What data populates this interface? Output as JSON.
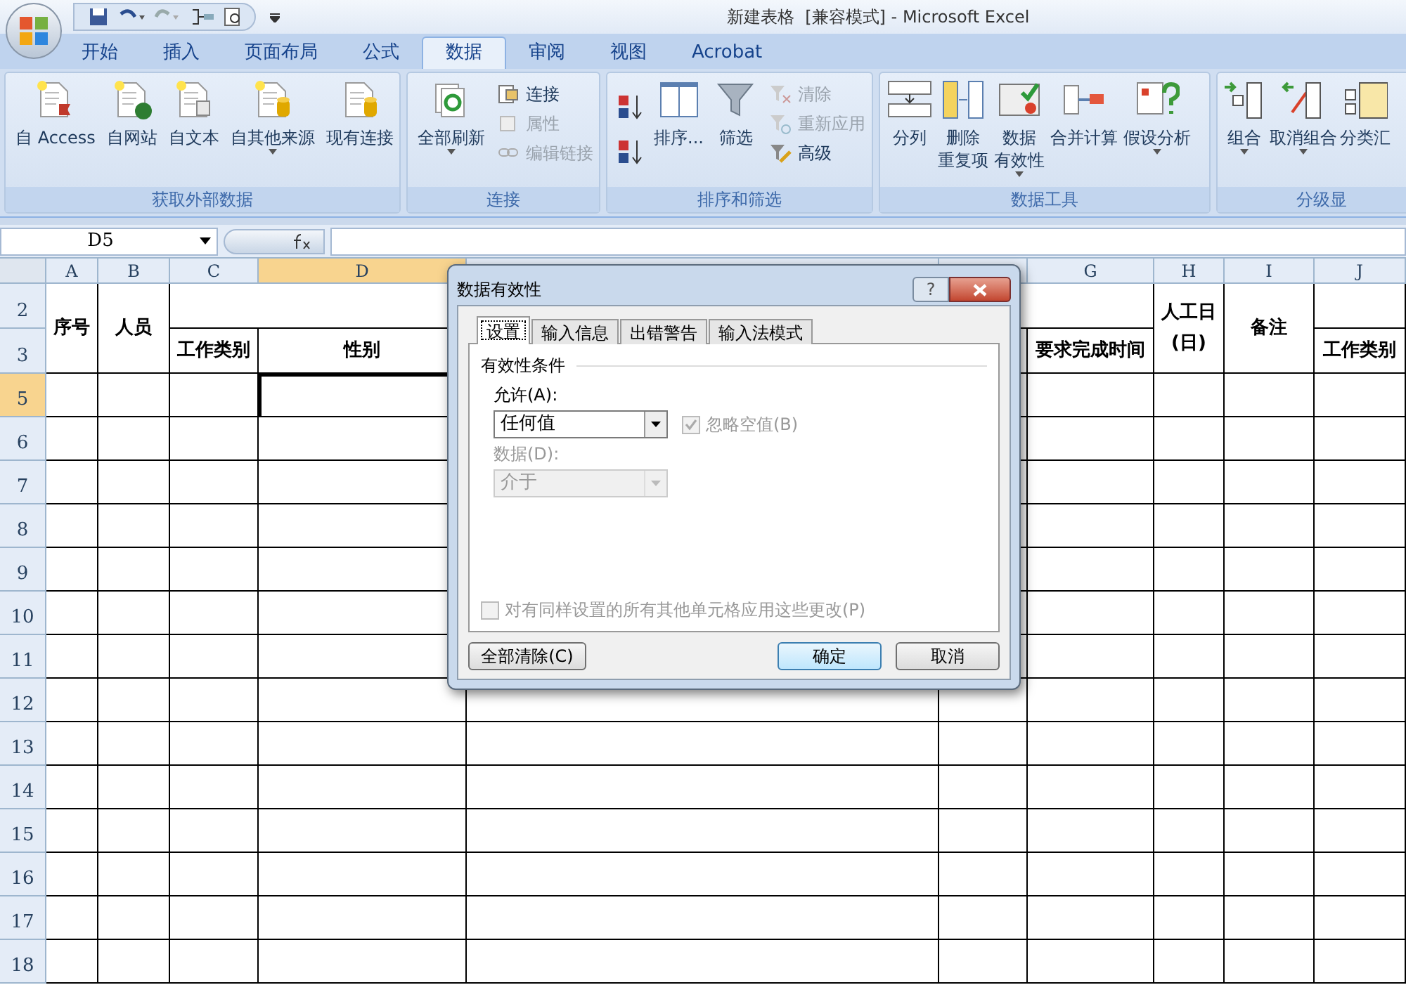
{
  "window": {
    "title": "新建表格  [兼容模式] - Microsoft Excel"
  },
  "tabs": [
    {
      "label": "开始",
      "selected": false
    },
    {
      "label": "插入",
      "selected": false
    },
    {
      "label": "页面布局",
      "selected": false
    },
    {
      "label": "公式",
      "selected": false
    },
    {
      "label": "数据",
      "selected": true
    },
    {
      "label": "审阅",
      "selected": false
    },
    {
      "label": "视图",
      "selected": false
    },
    {
      "label": "Acrobat",
      "selected": false
    }
  ],
  "ribbon": {
    "groups": [
      {
        "label": "获取外部数据",
        "items": [
          {
            "kind": "large",
            "label": "自 Access",
            "disabled": false
          },
          {
            "kind": "large",
            "label": "自网站",
            "disabled": false
          },
          {
            "kind": "large",
            "label": "自文本",
            "disabled": false
          },
          {
            "kind": "large",
            "label": "自其他来源",
            "disabled": false,
            "dropdown": true
          },
          {
            "kind": "large",
            "label": "现有连接",
            "disabled": false
          }
        ]
      },
      {
        "label": "连接",
        "items": [
          {
            "kind": "large",
            "label": "全部刷新",
            "disabled": false,
            "dropdown": true
          },
          {
            "kind": "small",
            "label": "连接",
            "disabled": false
          },
          {
            "kind": "small",
            "label": "属性",
            "disabled": true
          },
          {
            "kind": "small",
            "label": "编辑链接",
            "disabled": true
          }
        ]
      },
      {
        "label": "排序和筛选",
        "items": [
          {
            "kind": "icon",
            "disabled": false
          },
          {
            "kind": "icon",
            "disabled": false
          },
          {
            "kind": "large",
            "label": "排序...",
            "disabled": false
          },
          {
            "kind": "large",
            "label": "筛选",
            "disabled": false
          },
          {
            "kind": "small",
            "label": "清除",
            "disabled": true
          },
          {
            "kind": "small",
            "label": "重新应用",
            "disabled": true
          },
          {
            "kind": "small",
            "label": "高级",
            "disabled": false
          }
        ]
      },
      {
        "label": "数据工具",
        "items": [
          {
            "kind": "large",
            "label": "分列",
            "disabled": false
          },
          {
            "kind": "large",
            "label": "删除",
            "label_2": "重复项",
            "disabled": false
          },
          {
            "kind": "large",
            "label": "数据",
            "label_2": "有效性",
            "disabled": false,
            "dropdown": true
          },
          {
            "kind": "large",
            "label": "合并计算",
            "disabled": false
          },
          {
            "kind": "large",
            "label": "假设分析",
            "disabled": false,
            "dropdown": true
          }
        ]
      },
      {
        "label": "分级显",
        "items": [
          {
            "kind": "large",
            "label": "组合",
            "disabled": false,
            "dropdown": true
          },
          {
            "kind": "large",
            "label": "取消组合",
            "disabled": false,
            "dropdown": true
          },
          {
            "kind": "large",
            "label": "分类汇",
            "disabled": false
          }
        ]
      }
    ]
  },
  "formula_bar": {
    "name_box": "D5"
  },
  "sheet": {
    "columns": [
      {
        "header": "A",
        "selected": false
      },
      {
        "header": "B",
        "selected": false
      },
      {
        "header": "C",
        "selected": false
      },
      {
        "header": "D",
        "selected": true
      },
      {
        "selected": false
      },
      {
        "selected": false
      },
      {
        "header": "G",
        "selected": false
      },
      {
        "header": "H",
        "selected": false
      },
      {
        "header": "I",
        "selected": false
      },
      {
        "header": "J",
        "selected": false
      }
    ],
    "rows": [
      {
        "number": "2",
        "selected": false
      },
      {
        "number": "3",
        "selected": false
      },
      {
        "number": "5",
        "selected": true
      },
      {
        "number": "6",
        "selected": false
      },
      {
        "number": "7",
        "selected": false
      },
      {
        "number": "8",
        "selected": false
      },
      {
        "number": "9",
        "selected": false
      },
      {
        "number": "10",
        "selected": false
      },
      {
        "number": "11",
        "selected": false
      },
      {
        "number": "12",
        "selected": false
      },
      {
        "number": "13",
        "selected": false
      },
      {
        "number": "14",
        "selected": false
      },
      {
        "number": "15",
        "selected": false
      },
      {
        "number": "16",
        "selected": false
      },
      {
        "number": "17",
        "selected": false
      },
      {
        "number": "18",
        "selected": false
      }
    ],
    "header_cells": [
      "序号",
      "人员",
      "工作类别",
      "性别",
      "要求完成时间",
      "人工日\n(日)",
      "备注",
      "工作类别"
    ]
  },
  "dialog": {
    "title": "数据有效性",
    "help": "?",
    "tabs": [
      {
        "label": "设置",
        "selected": true
      },
      {
        "label": "输入信息",
        "selected": false
      },
      {
        "label": "出错警告",
        "selected": false
      },
      {
        "label": "输入法模式",
        "selected": false
      }
    ],
    "section": "有效性条件",
    "allow": {
      "label": "允许(A):",
      "value": "任何值",
      "disabled": false
    },
    "ignore_blank": {
      "label": "忽略空值(B)",
      "checked": true,
      "disabled": true
    },
    "data": {
      "label": "数据(D):",
      "value": "介于",
      "disabled": true
    },
    "apply_all": {
      "label": "对有同样设置的所有其他单元格应用这些更改(P)",
      "checked": false,
      "disabled": true
    },
    "buttons": [
      {
        "label": "全部清除(C)",
        "kind": "left"
      },
      {
        "label": "确定",
        "kind": "default"
      },
      {
        "label": "取消",
        "kind": "normal"
      }
    ]
  }
}
